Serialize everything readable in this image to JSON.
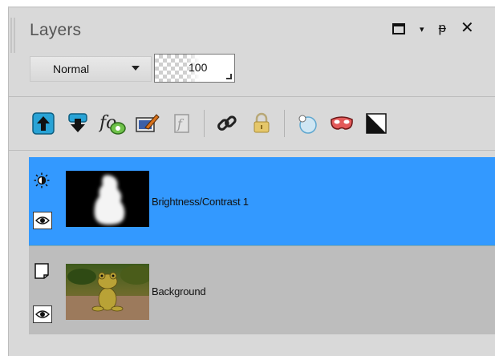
{
  "panel": {
    "title": "Layers",
    "controls": [
      "restore-icon",
      "menu-arrow-icon",
      "pin-icon",
      "close-icon"
    ],
    "control_glyphs": {
      "menu": "▾",
      "pin": "ᵽ",
      "close": "✕"
    }
  },
  "blend_mode": {
    "selected": "Normal"
  },
  "opacity": {
    "value": "100"
  },
  "toolbar": {
    "buttons": [
      "move-layer-up-icon",
      "move-layer-down-icon",
      "add-layer-effect-icon",
      "edit-layer-icon",
      "merge-layer-icon",
      "link-layers-icon",
      "lock-layer-icon",
      "add-mask-icon",
      "mask-options-icon",
      "adjustment-layer-icon"
    ]
  },
  "layers": [
    {
      "name": "Brightness/Contrast 1",
      "type": "adjustment",
      "visible": true,
      "selected": true
    },
    {
      "name": "Background",
      "type": "image",
      "visible": true,
      "selected": false
    }
  ],
  "colors": {
    "selected_row": "#3399ff",
    "panel_bg": "#d9d9d9",
    "layer_bg": "#bdbdbd"
  }
}
